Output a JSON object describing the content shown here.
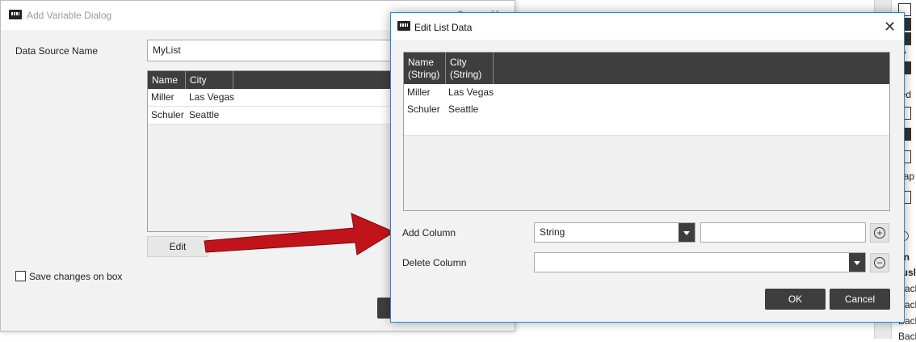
{
  "background_dialog": {
    "title": "Add Variable Dialog",
    "help": "?",
    "close": "✕",
    "data_source_label": "Data Source Name",
    "data_source_value": "MyList",
    "columns": [
      "Name",
      "City"
    ],
    "rows": [
      [
        "Miller",
        "Las Vegas"
      ],
      [
        "Schuler",
        "Seattle"
      ]
    ],
    "edit_button": "Edit",
    "save_checkbox_label": "Save changes on box"
  },
  "edit_dialog": {
    "title": "Edit List Data",
    "close": "✕",
    "columns": [
      {
        "name": "Name",
        "type": "(String)"
      },
      {
        "name": "City",
        "type": "(String)"
      }
    ],
    "rows": [
      [
        "Miller",
        "Las Vegas"
      ],
      [
        "Schuler",
        "Seattle"
      ]
    ],
    "add_column_label": "Add Column",
    "add_column_type": "String",
    "add_column_name": "",
    "delete_column_label": "Delete Column",
    "delete_column_value": "",
    "ok_button": "OK",
    "cancel_button": "Cancel"
  },
  "annotation": {
    "arrow_color": "#c0141a"
  },
  "side_panel_text": [
    "led",
    "hap",
    "en",
    "rusl",
    "Back",
    "Back",
    "Back",
    "Back"
  ],
  "colors": {
    "header_dark": "#3e3e3e",
    "focus_border": "#1e88e5"
  }
}
